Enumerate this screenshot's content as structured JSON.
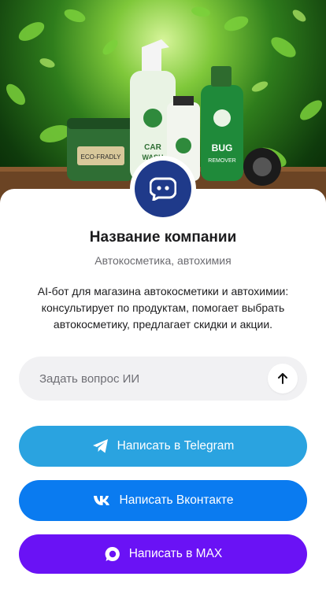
{
  "hero": {
    "image_name": "car-cosmetics-products-image"
  },
  "company": {
    "name": "Название компании",
    "category": "Автокосметика, автохимия",
    "description": "AI-бот для магазина автокосметики и автохимии: консультирует по продуктам, помогает выбрать автокосметику, предлагает скидки и акции."
  },
  "ask": {
    "placeholder": "Задать вопрос ИИ",
    "send_icon": "arrow-up-icon"
  },
  "buttons": {
    "telegram": {
      "label": "Написать в Telegram",
      "icon": "telegram-icon",
      "color": "#2aa3e0"
    },
    "vk": {
      "label": "Написать Вконтакте",
      "icon": "vk-icon",
      "color": "#0a7bf0"
    },
    "max": {
      "label": "Написать в MAX",
      "icon": "max-icon",
      "color": "#6a12f5"
    }
  },
  "colors": {
    "avatar": "#1f3a8a",
    "input_bg": "#f1f1f3"
  }
}
